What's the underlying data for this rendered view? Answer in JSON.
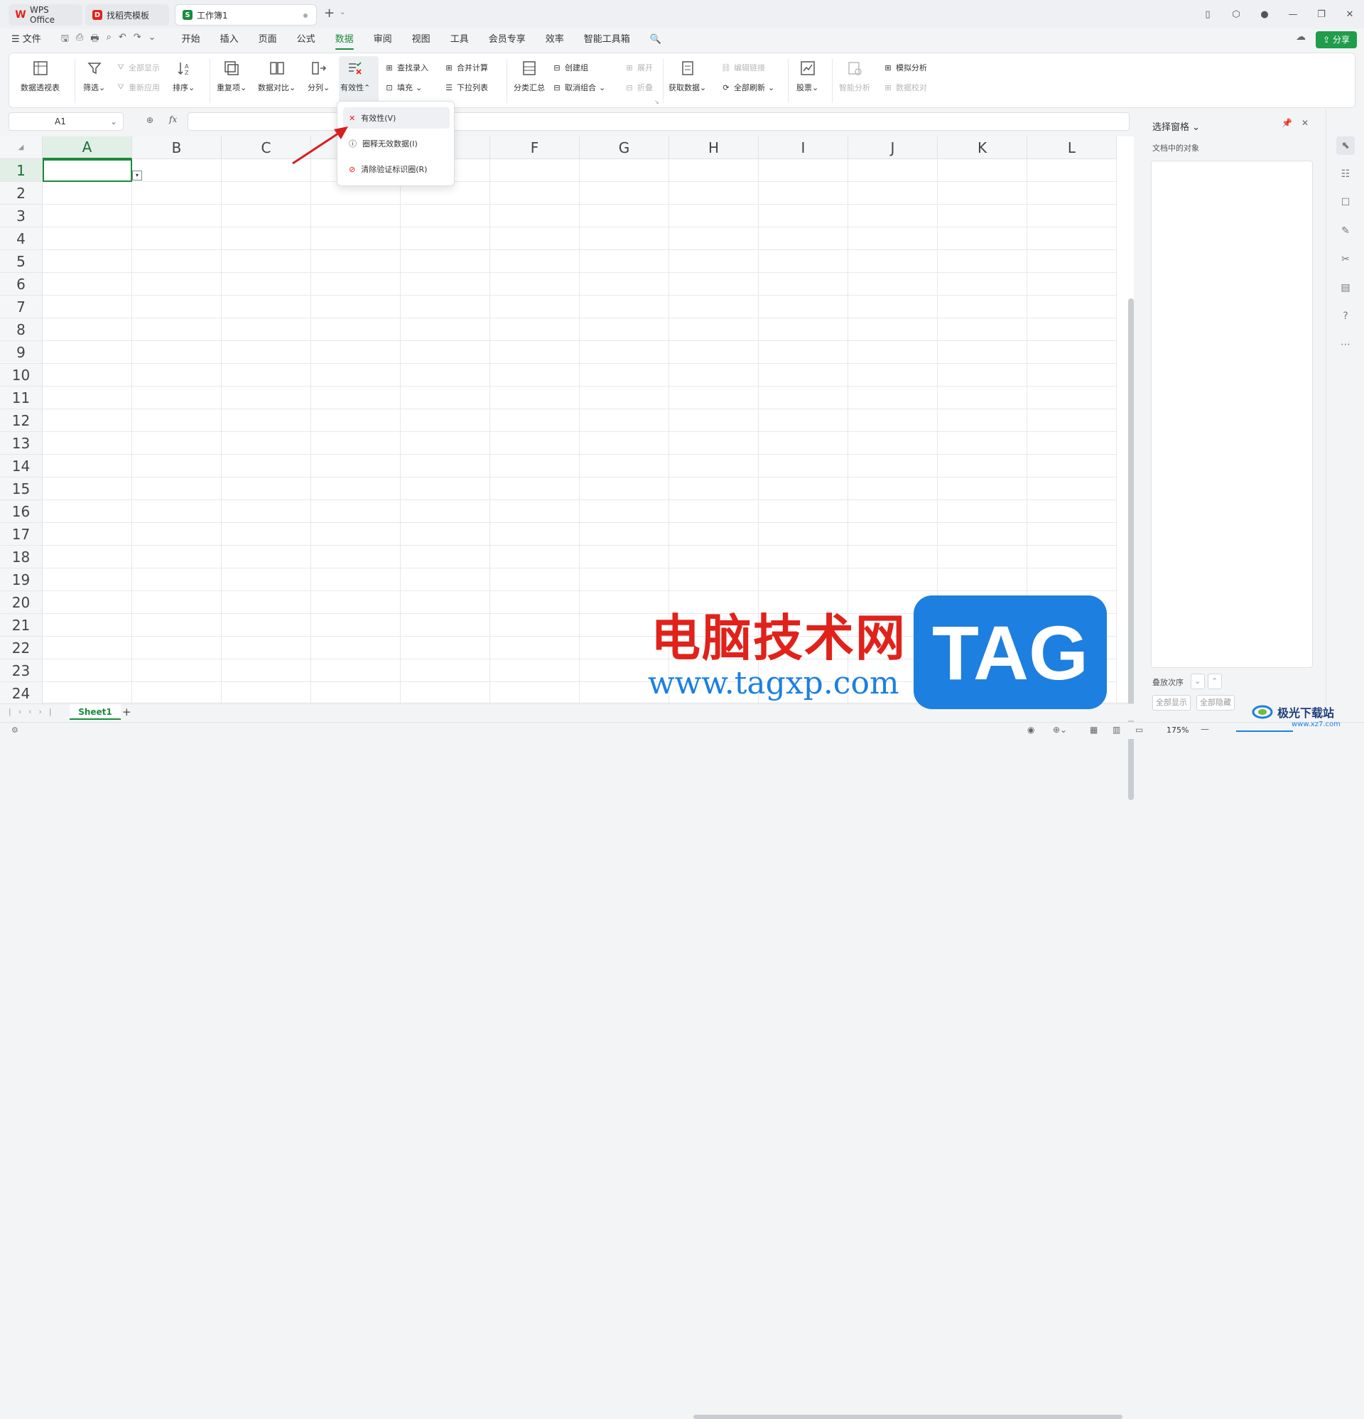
{
  "tabs": [
    {
      "label": "WPS Office",
      "icon": "wps-logo-icon"
    },
    {
      "label": "找稻壳模板",
      "icon": "docer-icon"
    },
    {
      "label": "工作簿1",
      "icon": "spreadsheet-icon"
    }
  ],
  "menu": {
    "file": "文件",
    "items": [
      "开始",
      "插入",
      "页面",
      "公式",
      "数据",
      "审阅",
      "视图",
      "工具",
      "会员专享",
      "效率",
      "智能工具箱"
    ],
    "active": "数据",
    "share": "分享"
  },
  "ribbon": {
    "pivot": "数据透视表",
    "filter": "筛选",
    "show_all": "全部显示",
    "reapply": "重新应用",
    "sort": "排序",
    "duplicates": "重复项",
    "compare": "数据对比",
    "split": "分列",
    "validity": "有效性",
    "lookup": "查找录入",
    "fill": "填充",
    "merge_calc": "合并计算",
    "dropdown_list": "下拉列表",
    "subtotal": "分类汇总",
    "create_group": "创建组",
    "ungroup": "取消组合",
    "expand": "展开",
    "collapse": "折叠",
    "get_data": "获取数据",
    "edit_links": "编辑链接",
    "refresh_all": "全部刷新",
    "stocks": "股票",
    "smart_analysis": "智能分析",
    "data_check": "数据校对",
    "what_if": "模拟分析"
  },
  "formula_bar": {
    "cell_ref": "A1",
    "fx": "fx"
  },
  "dropdown": {
    "items": [
      "有效性(V)",
      "圈释无效数据(I)",
      "清除验证标识圈(R)"
    ]
  },
  "columns": [
    "A",
    "B",
    "C",
    "D",
    "E",
    "F",
    "G",
    "H",
    "I",
    "J",
    "K",
    "L"
  ],
  "rows": [
    "1",
    "2",
    "3",
    "4",
    "5",
    "6",
    "7",
    "8",
    "9",
    "10",
    "11",
    "12",
    "13",
    "14",
    "15",
    "16",
    "17",
    "18",
    "19",
    "20",
    "21",
    "22",
    "23",
    "24"
  ],
  "sheet": {
    "name": "Sheet1",
    "add": "+"
  },
  "pane": {
    "title": "选择窗格",
    "subtitle": "文档中的对象",
    "order_label": "叠放次序",
    "show_all": "全部显示",
    "hide_all": "全部隐藏"
  },
  "status": {
    "zoom": "175%"
  },
  "watermark": {
    "title": "电脑技术网",
    "url": "www.tagxp.com",
    "tag": "TAG",
    "site2": "极光下载站",
    "site2_url": "www.xz7.com"
  },
  "colors": {
    "accent": "#1b8a3d",
    "share": "#1f9d4b",
    "wm_red": "#e0221b",
    "wm_blue": "#1d7fe0"
  }
}
